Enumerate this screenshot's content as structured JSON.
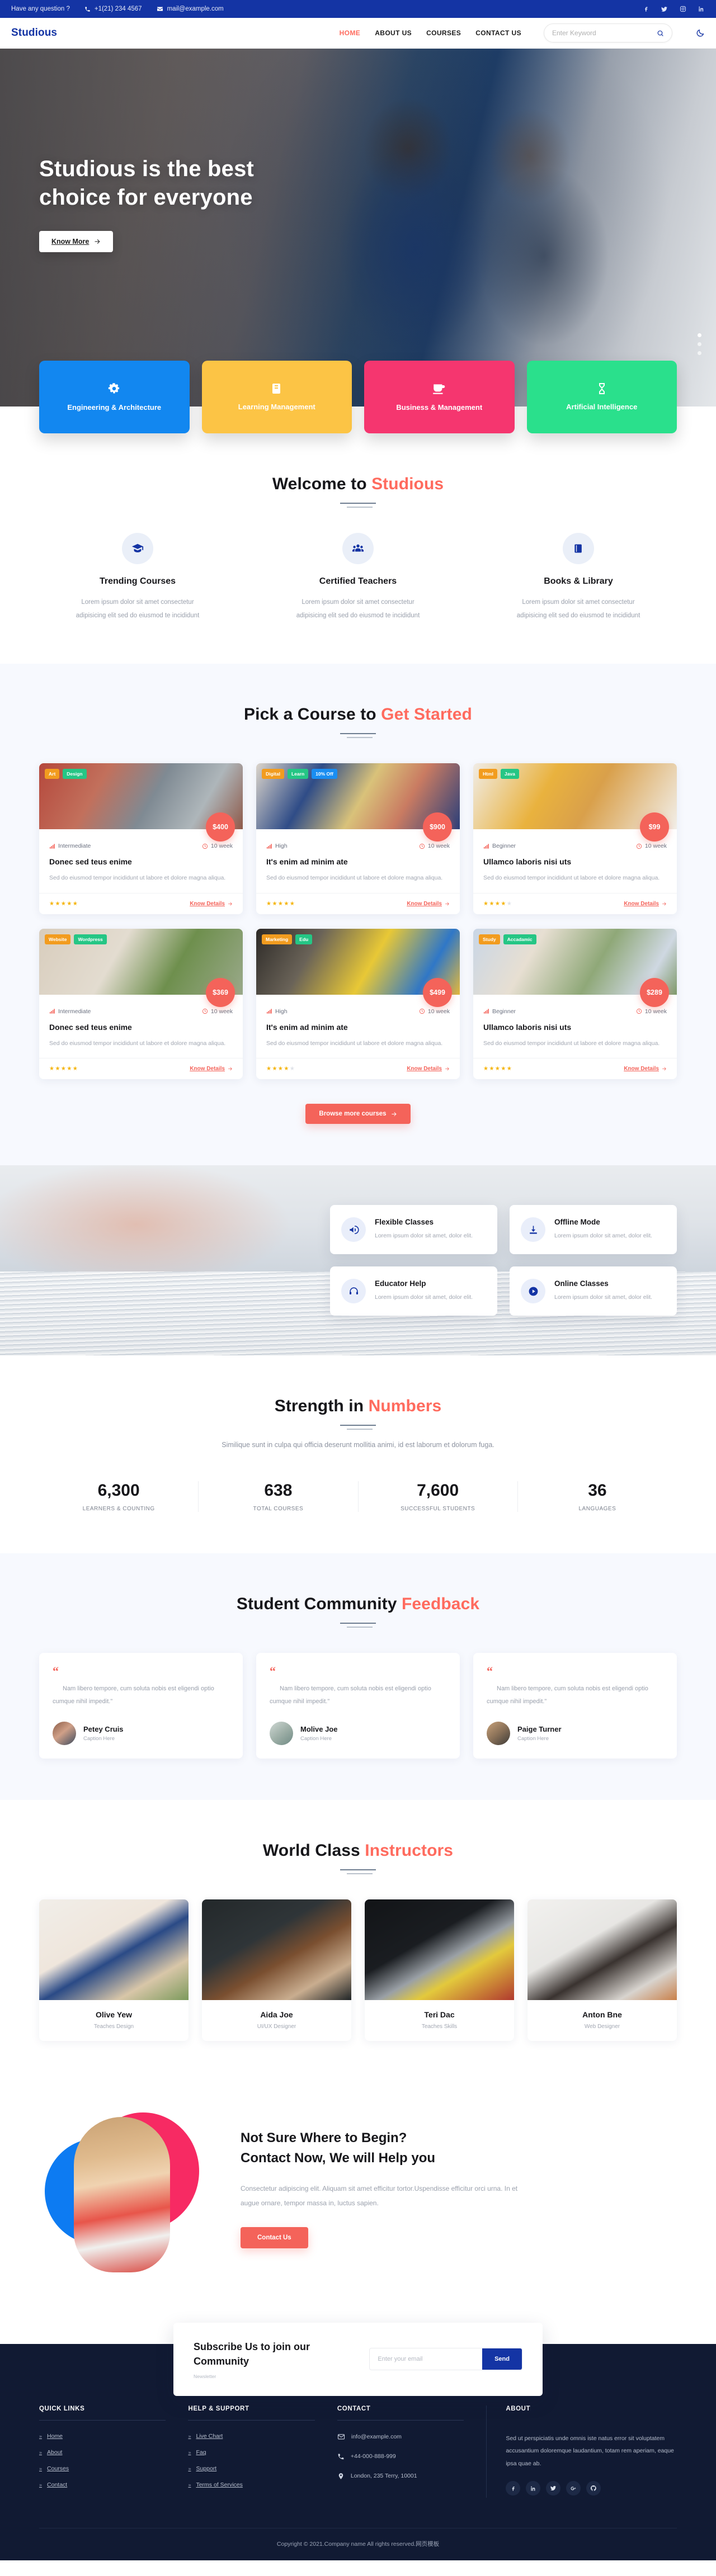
{
  "topbar": {
    "question": "Have any question ?",
    "phone": "+1(21) 234 4567",
    "email": "mail@example.com",
    "socials": [
      "facebook-icon",
      "twitter-icon",
      "instagram-icon",
      "linkedin-icon"
    ]
  },
  "nav": {
    "brand": "Studious",
    "links": [
      {
        "label": "HOME",
        "active": true
      },
      {
        "label": "ABOUT US",
        "active": false
      },
      {
        "label": "COURSES",
        "active": false
      },
      {
        "label": "CONTACT US",
        "active": false
      }
    ],
    "search_placeholder": "Enter Keyword",
    "search_value": "",
    "theme_toggle": "moon-icon"
  },
  "hero": {
    "title": "Studious is the best choice for everyone",
    "cta": "Know More"
  },
  "categories": [
    {
      "label": "Engineering & Architecture",
      "color": "#1287f0",
      "icon": "gears-icon"
    },
    {
      "label": "Learning Management",
      "color": "#fcc445",
      "icon": "book-icon"
    },
    {
      "label": "Business & Management",
      "color": "#f5366f",
      "icon": "coffee-cup-icon"
    },
    {
      "label": "Artificial Intelligence",
      "color": "#2ae08c",
      "icon": "hourglass-icon"
    }
  ],
  "welcome": {
    "title_main": "Welcome to ",
    "title_hl": "Studious",
    "features": [
      {
        "icon": "graduation-cap-icon",
        "title": "Trending Courses",
        "text": "Lorem ipsum dolor sit amet consectetur adipisicing elit sed do eiusmod te incididunt"
      },
      {
        "icon": "users-icon",
        "title": "Certified Teachers",
        "text": "Lorem ipsum dolor sit amet consectetur adipisicing elit sed do eiusmod te incididunt"
      },
      {
        "icon": "book-stack-icon",
        "title": "Books & Library",
        "text": "Lorem ipsum dolor sit amet consectetur adipisicing elit sed do eiusmod te incididunt"
      }
    ]
  },
  "courses": {
    "title_main": "Pick a Course to ",
    "title_hl": "Get Started",
    "browse_label": "Browse more courses",
    "items": [
      {
        "tags": [
          {
            "t": "Art",
            "c": "o"
          },
          {
            "t": "Design",
            "c": "g"
          }
        ],
        "price": "$400",
        "level": "Intermediate",
        "duration": "10 week",
        "title": "Donec sed teus enime",
        "desc": "Sed do eiusmod tempor incididunt ut labore et dolore magna aliqua.",
        "rating": 5,
        "link": "Know Details"
      },
      {
        "tags": [
          {
            "t": "Digital",
            "c": "o"
          },
          {
            "t": "Learn",
            "c": "g"
          },
          {
            "t": "10% Off",
            "c": "b"
          }
        ],
        "price": "$900",
        "level": "High",
        "duration": "10 week",
        "title": "It's enim ad minim ate",
        "desc": "Sed do eiusmod tempor incididunt ut labore et dolore magna aliqua.",
        "rating": 5,
        "link": "Know Details"
      },
      {
        "tags": [
          {
            "t": "Html",
            "c": "o"
          },
          {
            "t": "Java",
            "c": "g"
          }
        ],
        "price": "$99",
        "level": "Beginner",
        "duration": "10 week",
        "title": "Ullamco laboris nisi uts",
        "desc": "Sed do eiusmod tempor incididunt ut labore et dolore magna aliqua.",
        "rating": 4,
        "link": "Know Details"
      },
      {
        "tags": [
          {
            "t": "Website",
            "c": "o"
          },
          {
            "t": "Wordpress",
            "c": "g"
          }
        ],
        "price": "$369",
        "level": "Intermediate",
        "duration": "10 week",
        "title": "Donec sed teus enime",
        "desc": "Sed do eiusmod tempor incididunt ut labore et dolore magna aliqua.",
        "rating": 5,
        "link": "Know Details"
      },
      {
        "tags": [
          {
            "t": "Marketing",
            "c": "o"
          },
          {
            "t": "Edu",
            "c": "g"
          }
        ],
        "price": "$499",
        "level": "High",
        "duration": "10 week",
        "title": "It's enim ad minim ate",
        "desc": "Sed do eiusmod tempor incididunt ut labore et dolore magna aliqua.",
        "rating": 4,
        "link": "Know Details"
      },
      {
        "tags": [
          {
            "t": "Study",
            "c": "o"
          },
          {
            "t": "Accadamic",
            "c": "g"
          }
        ],
        "price": "$289",
        "level": "Beginner",
        "duration": "10 week",
        "title": "Ullamco laboris nisi uts",
        "desc": "Sed do eiusmod tempor incididunt ut labore et dolore magna aliqua.",
        "rating": 5,
        "link": "Know Details"
      }
    ]
  },
  "why": [
    {
      "icon": "megaphone-icon",
      "title": "Flexible Classes",
      "text": "Lorem ipsum dolor sit amet, dolor elit."
    },
    {
      "icon": "download-icon",
      "title": "Offline Mode",
      "text": "Lorem ipsum dolor sit amet, dolor elit."
    },
    {
      "icon": "headset-icon",
      "title": "Educator Help",
      "text": "Lorem ipsum dolor sit amet, dolor elit."
    },
    {
      "icon": "play-circle-icon",
      "title": "Online Classes",
      "text": "Lorem ipsum dolor sit amet, dolor elit."
    }
  ],
  "strength": {
    "title_main": "Strength in ",
    "title_hl": "Numbers",
    "subtitle": "Similique sunt in culpa qui officia deserunt mollitia animi, id est laborum et dolorum fuga.",
    "stats": [
      {
        "num": "6,300",
        "label": "LEARNERS & COUNTING"
      },
      {
        "num": "638",
        "label": "TOTAL COURSES"
      },
      {
        "num": "7,600",
        "label": "SUCCESSFUL STUDENTS"
      },
      {
        "num": "36",
        "label": "LANGUAGES"
      }
    ]
  },
  "testimonials": {
    "title_main": "Student Community ",
    "title_hl": "Feedback",
    "items": [
      {
        "text": "Nam libero tempore, cum soluta nobis est eligendi optio cumque nihil impedit.\"",
        "name": "Petey Cruis",
        "caption": "Caption Here"
      },
      {
        "text": "Nam libero tempore, cum soluta nobis est eligendi optio cumque nihil impedit.\"",
        "name": "Molive Joe",
        "caption": "Caption Here"
      },
      {
        "text": "Nam libero tempore, cum soluta nobis est eligendi optio cumque nihil impedit.\"",
        "name": "Paige Turner",
        "caption": "Caption Here"
      }
    ]
  },
  "instructors": {
    "title_main": "World Class ",
    "title_hl": "Instructors",
    "items": [
      {
        "name": "Olive Yew",
        "role": "Teaches Design"
      },
      {
        "name": "Aida Joe",
        "role": "UI/UX Designer"
      },
      {
        "name": "Teri Dac",
        "role": "Teaches Skills"
      },
      {
        "name": "Anton Bne",
        "role": "Web Designer"
      }
    ]
  },
  "cta": {
    "line1": "Not Sure Where to Begin?",
    "line2": "Contact Now, We will Help you",
    "text": "Consectetur adipiscing elit. Aliquam sit amet efficitur tortor.Uspendisse efficitur orci urna. In et augue ornare, tempor massa in, luctus sapien.",
    "button": "Contact Us"
  },
  "subscribe": {
    "title": "Subscribe Us to join our Community",
    "note": "Newsletter",
    "placeholder": "Enter your email",
    "value": "",
    "button": "Send"
  },
  "footer": {
    "quick": {
      "title": "QUICK LINKS",
      "items": [
        "Home",
        "About",
        "Courses",
        "Contact"
      ]
    },
    "help": {
      "title": "HELP & SUPPORT",
      "items": [
        "Live Chart",
        "Faq",
        "Support",
        "Terms of Services"
      ]
    },
    "contact": {
      "title": "CONTACT",
      "email": "info@example.com",
      "phone": "+44-000-888-999",
      "address": "London, 235 Terry, 10001"
    },
    "about": {
      "title": "ABOUT",
      "text": "Sed ut perspiciatis unde omnis iste natus error sit voluptatem accusantium doloremque laudantium, totam rem aperiam, eaque ipsa quae ab.",
      "socials": [
        "facebook-icon",
        "linkedin-icon",
        "twitter-icon",
        "google-plus-icon",
        "github-icon"
      ]
    },
    "copyright": "Copyright © 2021.Company name All rights reserved.网页模板"
  },
  "colors": {
    "brand": "#1434a4",
    "accent": "#ff6b5e",
    "coral": "#f4635a",
    "footer_bg": "#111a33"
  }
}
